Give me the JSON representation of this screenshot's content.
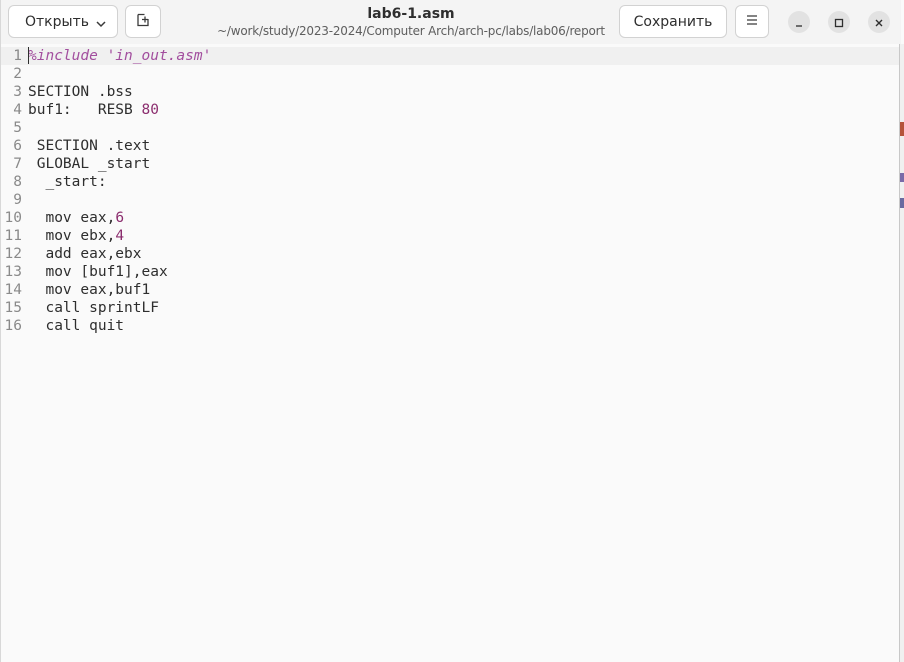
{
  "header": {
    "open_label": "Открыть",
    "save_label": "Сохранить",
    "title": "lab6-1.asm",
    "path": "~/work/study/2023-2024/Computer Arch/arch-pc/labs/lab06/report"
  },
  "icons": {
    "open_dropdown": "chevron-down-icon",
    "new_tab": "new-tab-icon",
    "menu": "hamburger-menu-icon",
    "minimize": "minimize-icon",
    "maximize": "maximize-icon",
    "close": "close-icon"
  },
  "editor": {
    "lines": [
      {
        "n": "1",
        "text": "%include 'in_out.asm'"
      },
      {
        "n": "2",
        "text": ""
      },
      {
        "n": "3",
        "text": "SECTION .bss"
      },
      {
        "n": "4",
        "text": "buf1:   RESB 80"
      },
      {
        "n": "5",
        "text": ""
      },
      {
        "n": "6",
        "text": " SECTION .text"
      },
      {
        "n": "7",
        "text": " GLOBAL _start"
      },
      {
        "n": "8",
        "text": "  _start:"
      },
      {
        "n": "9",
        "text": ""
      },
      {
        "n": "10",
        "text": "  mov eax,6"
      },
      {
        "n": "11",
        "text": "  mov ebx,4"
      },
      {
        "n": "12",
        "text": "  add eax,ebx"
      },
      {
        "n": "13",
        "text": "  mov [buf1],eax"
      },
      {
        "n": "14",
        "text": "  mov eax,buf1"
      },
      {
        "n": "15",
        "text": "  call sprintLF"
      },
      {
        "n": "16",
        "text": "  call quit"
      }
    ]
  },
  "colors": {
    "preprocessor": "#a24e9e",
    "number": "#8b2d6e",
    "text": "#2e2e2e",
    "line_number": "#8a8a8a"
  }
}
